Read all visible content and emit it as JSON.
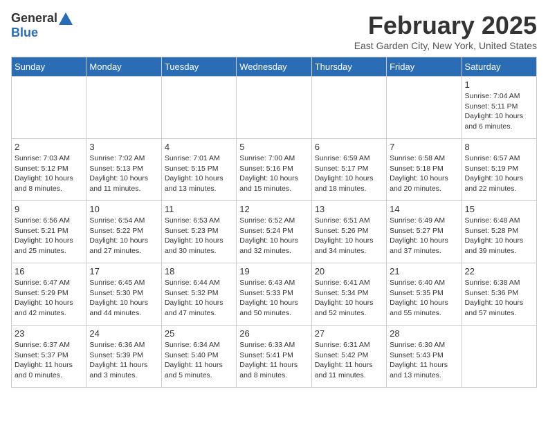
{
  "logo": {
    "line1": "General",
    "line2": "Blue"
  },
  "title": "February 2025",
  "subtitle": "East Garden City, New York, United States",
  "days_of_week": [
    "Sunday",
    "Monday",
    "Tuesday",
    "Wednesday",
    "Thursday",
    "Friday",
    "Saturday"
  ],
  "weeks": [
    [
      {
        "day": "",
        "info": ""
      },
      {
        "day": "",
        "info": ""
      },
      {
        "day": "",
        "info": ""
      },
      {
        "day": "",
        "info": ""
      },
      {
        "day": "",
        "info": ""
      },
      {
        "day": "",
        "info": ""
      },
      {
        "day": "1",
        "info": "Sunrise: 7:04 AM\nSunset: 5:11 PM\nDaylight: 10 hours\nand 6 minutes."
      }
    ],
    [
      {
        "day": "2",
        "info": "Sunrise: 7:03 AM\nSunset: 5:12 PM\nDaylight: 10 hours\nand 8 minutes."
      },
      {
        "day": "3",
        "info": "Sunrise: 7:02 AM\nSunset: 5:13 PM\nDaylight: 10 hours\nand 11 minutes."
      },
      {
        "day": "4",
        "info": "Sunrise: 7:01 AM\nSunset: 5:15 PM\nDaylight: 10 hours\nand 13 minutes."
      },
      {
        "day": "5",
        "info": "Sunrise: 7:00 AM\nSunset: 5:16 PM\nDaylight: 10 hours\nand 15 minutes."
      },
      {
        "day": "6",
        "info": "Sunrise: 6:59 AM\nSunset: 5:17 PM\nDaylight: 10 hours\nand 18 minutes."
      },
      {
        "day": "7",
        "info": "Sunrise: 6:58 AM\nSunset: 5:18 PM\nDaylight: 10 hours\nand 20 minutes."
      },
      {
        "day": "8",
        "info": "Sunrise: 6:57 AM\nSunset: 5:19 PM\nDaylight: 10 hours\nand 22 minutes."
      }
    ],
    [
      {
        "day": "9",
        "info": "Sunrise: 6:56 AM\nSunset: 5:21 PM\nDaylight: 10 hours\nand 25 minutes."
      },
      {
        "day": "10",
        "info": "Sunrise: 6:54 AM\nSunset: 5:22 PM\nDaylight: 10 hours\nand 27 minutes."
      },
      {
        "day": "11",
        "info": "Sunrise: 6:53 AM\nSunset: 5:23 PM\nDaylight: 10 hours\nand 30 minutes."
      },
      {
        "day": "12",
        "info": "Sunrise: 6:52 AM\nSunset: 5:24 PM\nDaylight: 10 hours\nand 32 minutes."
      },
      {
        "day": "13",
        "info": "Sunrise: 6:51 AM\nSunset: 5:26 PM\nDaylight: 10 hours\nand 34 minutes."
      },
      {
        "day": "14",
        "info": "Sunrise: 6:49 AM\nSunset: 5:27 PM\nDaylight: 10 hours\nand 37 minutes."
      },
      {
        "day": "15",
        "info": "Sunrise: 6:48 AM\nSunset: 5:28 PM\nDaylight: 10 hours\nand 39 minutes."
      }
    ],
    [
      {
        "day": "16",
        "info": "Sunrise: 6:47 AM\nSunset: 5:29 PM\nDaylight: 10 hours\nand 42 minutes."
      },
      {
        "day": "17",
        "info": "Sunrise: 6:45 AM\nSunset: 5:30 PM\nDaylight: 10 hours\nand 44 minutes."
      },
      {
        "day": "18",
        "info": "Sunrise: 6:44 AM\nSunset: 5:32 PM\nDaylight: 10 hours\nand 47 minutes."
      },
      {
        "day": "19",
        "info": "Sunrise: 6:43 AM\nSunset: 5:33 PM\nDaylight: 10 hours\nand 50 minutes."
      },
      {
        "day": "20",
        "info": "Sunrise: 6:41 AM\nSunset: 5:34 PM\nDaylight: 10 hours\nand 52 minutes."
      },
      {
        "day": "21",
        "info": "Sunrise: 6:40 AM\nSunset: 5:35 PM\nDaylight: 10 hours\nand 55 minutes."
      },
      {
        "day": "22",
        "info": "Sunrise: 6:38 AM\nSunset: 5:36 PM\nDaylight: 10 hours\nand 57 minutes."
      }
    ],
    [
      {
        "day": "23",
        "info": "Sunrise: 6:37 AM\nSunset: 5:37 PM\nDaylight: 11 hours\nand 0 minutes."
      },
      {
        "day": "24",
        "info": "Sunrise: 6:36 AM\nSunset: 5:39 PM\nDaylight: 11 hours\nand 3 minutes."
      },
      {
        "day": "25",
        "info": "Sunrise: 6:34 AM\nSunset: 5:40 PM\nDaylight: 11 hours\nand 5 minutes."
      },
      {
        "day": "26",
        "info": "Sunrise: 6:33 AM\nSunset: 5:41 PM\nDaylight: 11 hours\nand 8 minutes."
      },
      {
        "day": "27",
        "info": "Sunrise: 6:31 AM\nSunset: 5:42 PM\nDaylight: 11 hours\nand 11 minutes."
      },
      {
        "day": "28",
        "info": "Sunrise: 6:30 AM\nSunset: 5:43 PM\nDaylight: 11 hours\nand 13 minutes."
      },
      {
        "day": "",
        "info": ""
      }
    ]
  ]
}
